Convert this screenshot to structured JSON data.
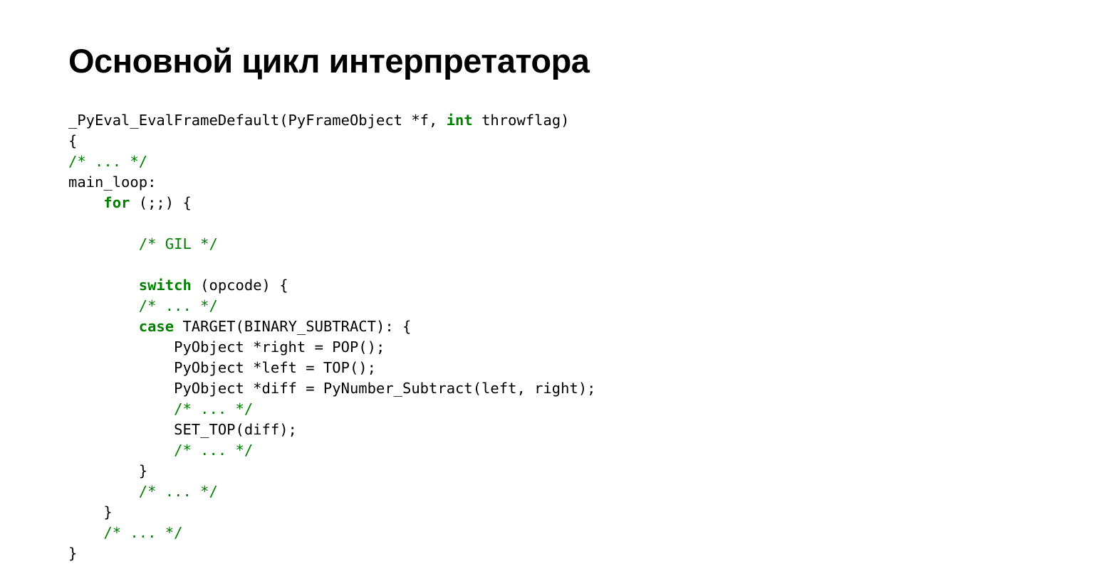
{
  "title": "Основной цикл интерпретатора",
  "code": {
    "lines": [
      [
        {
          "t": "_PyEval_EvalFrameDefault(PyFrameObject *f, ",
          "c": ""
        },
        {
          "t": "int",
          "c": "kw"
        },
        {
          "t": " throwflag)",
          "c": ""
        }
      ],
      [
        {
          "t": "{",
          "c": ""
        }
      ],
      [
        {
          "t": "/* ... */",
          "c": "cm"
        }
      ],
      [
        {
          "t": "main_loop:",
          "c": ""
        }
      ],
      [
        {
          "t": "    ",
          "c": ""
        },
        {
          "t": "for",
          "c": "kw"
        },
        {
          "t": " (;;) {",
          "c": ""
        }
      ],
      [
        {
          "t": "",
          "c": ""
        }
      ],
      [
        {
          "t": "        ",
          "c": ""
        },
        {
          "t": "/* GIL */",
          "c": "cm"
        }
      ],
      [
        {
          "t": "",
          "c": ""
        }
      ],
      [
        {
          "t": "        ",
          "c": ""
        },
        {
          "t": "switch",
          "c": "kw"
        },
        {
          "t": " (opcode) {",
          "c": ""
        }
      ],
      [
        {
          "t": "        ",
          "c": ""
        },
        {
          "t": "/* ... */",
          "c": "cm"
        }
      ],
      [
        {
          "t": "        ",
          "c": ""
        },
        {
          "t": "case",
          "c": "kw"
        },
        {
          "t": " TARGET(BINARY_SUBTRACT): {",
          "c": ""
        }
      ],
      [
        {
          "t": "            PyObject *right = POP();",
          "c": ""
        }
      ],
      [
        {
          "t": "            PyObject *left = TOP();",
          "c": ""
        }
      ],
      [
        {
          "t": "            PyObject *diff = PyNumber_Subtract(left, right);",
          "c": ""
        }
      ],
      [
        {
          "t": "            ",
          "c": ""
        },
        {
          "t": "/* ... */",
          "c": "cm"
        }
      ],
      [
        {
          "t": "            SET_TOP(diff);",
          "c": ""
        }
      ],
      [
        {
          "t": "            ",
          "c": ""
        },
        {
          "t": "/* ... */",
          "c": "cm"
        }
      ],
      [
        {
          "t": "        }",
          "c": ""
        }
      ],
      [
        {
          "t": "        ",
          "c": ""
        },
        {
          "t": "/* ... */",
          "c": "cm"
        }
      ],
      [
        {
          "t": "    }",
          "c": ""
        }
      ],
      [
        {
          "t": "    ",
          "c": ""
        },
        {
          "t": "/* ... */",
          "c": "cm"
        }
      ],
      [
        {
          "t": "}",
          "c": ""
        }
      ]
    ]
  }
}
